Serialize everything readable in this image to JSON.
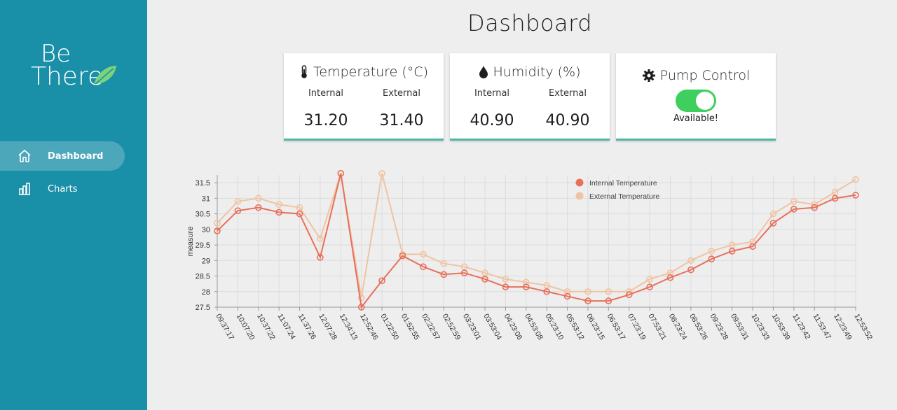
{
  "sidebar": {
    "logo_line1": "Be",
    "logo_line2": "There",
    "items": [
      {
        "label": "Dashboard",
        "icon": "home-icon",
        "active": true
      },
      {
        "label": "Charts",
        "icon": "bar-chart-icon",
        "active": false
      }
    ]
  },
  "page_title": "Dashboard",
  "cards": {
    "temperature": {
      "title": "Temperature (°C)",
      "icon": "thermometer-icon",
      "internal_label": "Internal",
      "external_label": "External",
      "internal_value": "31.20",
      "external_value": "31.40"
    },
    "humidity": {
      "title": "Humidity (%)",
      "icon": "droplet-icon",
      "internal_label": "Internal",
      "external_label": "External",
      "internal_value": "40.90",
      "external_value": "40.90"
    },
    "pump": {
      "title": "Pump Control",
      "icon": "gear-icon",
      "toggle_on": true,
      "status": "Available!"
    }
  },
  "colors": {
    "sidebar": "#1a8fa8",
    "card_border": "#4fb6a6",
    "toggle_on": "#3ecf5e",
    "internal_series": "#e8705a",
    "external_series": "#efc4a4"
  },
  "chart_data": {
    "type": "line",
    "ylabel": "measure",
    "ylim": [
      27.5,
      31.75
    ],
    "yticks": [
      "27.5",
      "28",
      "28.5",
      "29",
      "29.5",
      "30",
      "30.5",
      "31",
      "31.5"
    ],
    "grid": true,
    "legend_position": "top-right",
    "categories": [
      "09:37:17",
      "10:07:20",
      "10:37:22",
      "11:07:24",
      "11:37:26",
      "12:07:28",
      "12:34:13",
      "12:52:46",
      "01:22:50",
      "01:52:55",
      "02:22:57",
      "02:52:59",
      "03:23:01",
      "03:53:04",
      "04:23:06",
      "04:53:08",
      "05:23:10",
      "05:53:12",
      "06:23:15",
      "06:53:17",
      "07:23:19",
      "07:53:21",
      "08:23:24",
      "08:53:26",
      "09:23:28",
      "09:53:31",
      "10:23:33",
      "10:53:39",
      "11:23:42",
      "11:53:47",
      "12:23:49",
      "12:53:52"
    ],
    "series": [
      {
        "name": "Internal Temperature",
        "values": [
          29.95,
          30.6,
          30.7,
          30.55,
          30.5,
          29.1,
          31.8,
          27.5,
          28.35,
          29.15,
          28.8,
          28.55,
          28.6,
          28.4,
          28.15,
          28.15,
          28.0,
          27.85,
          27.7,
          27.7,
          27.9,
          28.15,
          28.45,
          28.7,
          29.05,
          29.3,
          29.45,
          30.2,
          30.65,
          30.7,
          31.0,
          31.1
        ]
      },
      {
        "name": "External Temperature",
        "values": [
          30.2,
          30.9,
          31.0,
          30.8,
          30.7,
          29.7,
          31.8,
          27.8,
          31.8,
          29.2,
          29.2,
          28.9,
          28.8,
          28.6,
          28.4,
          28.3,
          28.2,
          28.0,
          28.0,
          28.0,
          28.0,
          28.4,
          28.6,
          29.0,
          29.3,
          29.5,
          29.6,
          30.5,
          30.9,
          30.8,
          31.2,
          31.6
        ]
      }
    ]
  }
}
